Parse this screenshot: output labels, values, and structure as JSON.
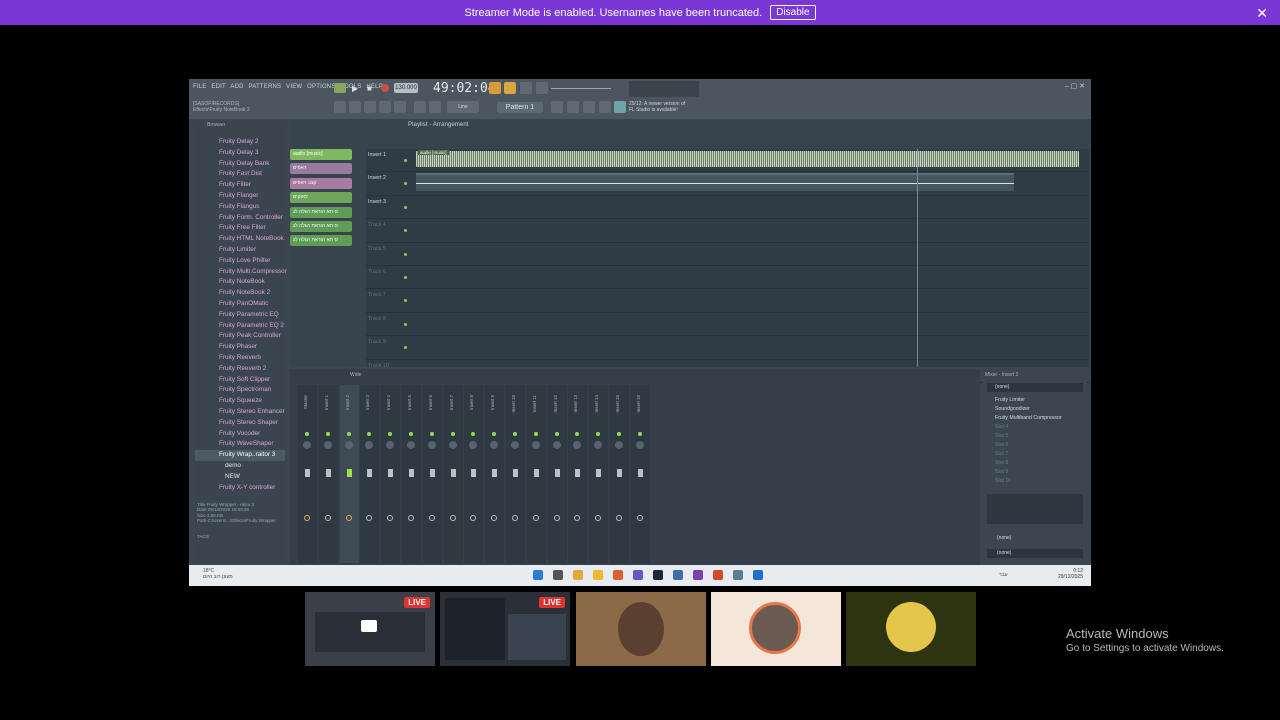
{
  "banner": {
    "text": "Streamer Mode is enabled. Usernames have been truncated.",
    "disable_label": "Disable",
    "close_icon": "close-icon",
    "color": "#7b36d6"
  },
  "fl": {
    "menu": [
      "FILE",
      "EDIT",
      "ADD",
      "PATTERNS",
      "VIEW",
      "OPTIONS",
      "TOOLS",
      "HELP"
    ],
    "tempo": "130.000",
    "time": "49:02:04",
    "pattern": "Pattern 1",
    "path1": "[SASOFIRECORDS]",
    "path2": "Effects\\Fruity NoteBook 2",
    "news1": "29/12: A newer version of",
    "news2": "FL Studio is available!",
    "playlist_title": "Playlist - Arrangement",
    "browser_label": "Browser",
    "browser_items": [
      "Fruity Delay 2",
      "Fruity Delay 3",
      "Fruity Delay Bank",
      "Fruity Fast Dist",
      "Fruity Filter",
      "Fruity Flanger",
      "Fruity Flangus",
      "Fruity Form. Controller",
      "Fruity Free Filter",
      "Fruity HTML NoteBook",
      "Fruity Limiter",
      "Fruity Love Philter",
      "Fruity Multi.Compressor",
      "Fruity NoteBook",
      "Fruity NoteBook 2",
      "Fruity PanOMatic",
      "Fruity Parametric EQ",
      "Fruity Parametric EQ 2",
      "Fruity Peak Controller",
      "Fruity Phaser",
      "Fruity Reeverb",
      "Fruity Reeverb 2",
      "Fruity Soft Clipper",
      "Fruity Spectroman",
      "Fruity Squeeze",
      "Fruity Stereo Enhancer",
      "Fruity Stereo Shaper",
      "Fruity Vocoder",
      "Fruity WaveShaper",
      "Fruity Wrap..raitor 3"
    ],
    "browser_sub": [
      "demo",
      "NEW"
    ],
    "browser_last": "Fruity X-Y controller",
    "browser_meta": [
      "Title   Fruity Wrapper - raitor 3",
      "Date    29/12/2025 19:59:36",
      "Size    3.96 KB",
      "Path    C:\\Users\\...\\Effects\\Fruity Wrapper"
    ],
    "tags_label": "TAGS",
    "channels": [
      {
        "name": "audio [music]",
        "color": "#7fb85f"
      },
      {
        "name": "ראפים",
        "color": "#9a7ba0"
      },
      {
        "name": "קצב ראפים",
        "color": "#a77ca0"
      },
      {
        "name": "לאוקים",
        "color": "#6ea65a"
      },
      {
        "name": "ס תא הוראת הגלה לג",
        "color": "#5f9d57"
      },
      {
        "name": "ס תא הוראת הגלה לג",
        "color": "#5f9d57"
      },
      {
        "name": "ס תא הוראת הגלה לג",
        "color": "#5f9d57"
      }
    ],
    "tracks": [
      "Insert 1",
      "Insert 2",
      "Insert 3",
      "Track 4",
      "Track 5",
      "Track 6",
      "Track 7",
      "Track 8",
      "Track 9",
      "Track 10"
    ],
    "clip1": "audio [music]",
    "mixer_label": "Wide",
    "mixer_tracks": [
      "Master",
      "Insert 1",
      "Insert 2",
      "Insert 3",
      "Insert 4",
      "Insert 5",
      "Insert 6",
      "Insert 7",
      "Insert 8",
      "Insert 9",
      "Insert 10",
      "Insert 11",
      "Insert 12",
      "Insert 13",
      "Insert 14",
      "Insert 15",
      "Insert 16"
    ],
    "mixer_panel_title": "Mixer - Insert 2",
    "fx_top": "(none)",
    "fx_slots": [
      "Fruity Limiter",
      "Soundgoodizer",
      "Fruity Multiband Compressor",
      "Slot 4",
      "Slot 5",
      "Slot 6",
      "Slot 7",
      "Slot 8",
      "Slot 9",
      "Slot 10"
    ],
    "fx_bottom1": "(none)",
    "fx_bottom2": "(none)"
  },
  "taskbar": {
    "temp": "18°C",
    "weather": "מעונן רוב היום",
    "time": "0:12",
    "date": "29/12/2025",
    "lang": "עבר"
  },
  "cams": [
    {
      "label": "LIVE"
    },
    {
      "label": "LIVE"
    }
  ],
  "activate": {
    "title": "Activate Windows",
    "sub": "Go to Settings to activate Windows."
  }
}
